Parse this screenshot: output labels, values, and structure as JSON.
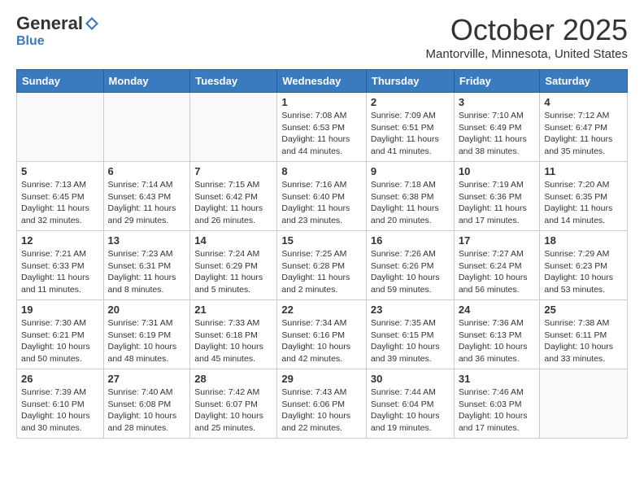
{
  "header": {
    "logo_general": "General",
    "logo_blue": "Blue",
    "month": "October 2025",
    "location": "Mantorville, Minnesota, United States"
  },
  "days_of_week": [
    "Sunday",
    "Monday",
    "Tuesday",
    "Wednesday",
    "Thursday",
    "Friday",
    "Saturday"
  ],
  "weeks": [
    [
      {
        "day": "",
        "info": ""
      },
      {
        "day": "",
        "info": ""
      },
      {
        "day": "",
        "info": ""
      },
      {
        "day": "1",
        "info": "Sunrise: 7:08 AM\nSunset: 6:53 PM\nDaylight: 11 hours and 44 minutes."
      },
      {
        "day": "2",
        "info": "Sunrise: 7:09 AM\nSunset: 6:51 PM\nDaylight: 11 hours and 41 minutes."
      },
      {
        "day": "3",
        "info": "Sunrise: 7:10 AM\nSunset: 6:49 PM\nDaylight: 11 hours and 38 minutes."
      },
      {
        "day": "4",
        "info": "Sunrise: 7:12 AM\nSunset: 6:47 PM\nDaylight: 11 hours and 35 minutes."
      }
    ],
    [
      {
        "day": "5",
        "info": "Sunrise: 7:13 AM\nSunset: 6:45 PM\nDaylight: 11 hours and 32 minutes."
      },
      {
        "day": "6",
        "info": "Sunrise: 7:14 AM\nSunset: 6:43 PM\nDaylight: 11 hours and 29 minutes."
      },
      {
        "day": "7",
        "info": "Sunrise: 7:15 AM\nSunset: 6:42 PM\nDaylight: 11 hours and 26 minutes."
      },
      {
        "day": "8",
        "info": "Sunrise: 7:16 AM\nSunset: 6:40 PM\nDaylight: 11 hours and 23 minutes."
      },
      {
        "day": "9",
        "info": "Sunrise: 7:18 AM\nSunset: 6:38 PM\nDaylight: 11 hours and 20 minutes."
      },
      {
        "day": "10",
        "info": "Sunrise: 7:19 AM\nSunset: 6:36 PM\nDaylight: 11 hours and 17 minutes."
      },
      {
        "day": "11",
        "info": "Sunrise: 7:20 AM\nSunset: 6:35 PM\nDaylight: 11 hours and 14 minutes."
      }
    ],
    [
      {
        "day": "12",
        "info": "Sunrise: 7:21 AM\nSunset: 6:33 PM\nDaylight: 11 hours and 11 minutes."
      },
      {
        "day": "13",
        "info": "Sunrise: 7:23 AM\nSunset: 6:31 PM\nDaylight: 11 hours and 8 minutes."
      },
      {
        "day": "14",
        "info": "Sunrise: 7:24 AM\nSunset: 6:29 PM\nDaylight: 11 hours and 5 minutes."
      },
      {
        "day": "15",
        "info": "Sunrise: 7:25 AM\nSunset: 6:28 PM\nDaylight: 11 hours and 2 minutes."
      },
      {
        "day": "16",
        "info": "Sunrise: 7:26 AM\nSunset: 6:26 PM\nDaylight: 10 hours and 59 minutes."
      },
      {
        "day": "17",
        "info": "Sunrise: 7:27 AM\nSunset: 6:24 PM\nDaylight: 10 hours and 56 minutes."
      },
      {
        "day": "18",
        "info": "Sunrise: 7:29 AM\nSunset: 6:23 PM\nDaylight: 10 hours and 53 minutes."
      }
    ],
    [
      {
        "day": "19",
        "info": "Sunrise: 7:30 AM\nSunset: 6:21 PM\nDaylight: 10 hours and 50 minutes."
      },
      {
        "day": "20",
        "info": "Sunrise: 7:31 AM\nSunset: 6:19 PM\nDaylight: 10 hours and 48 minutes."
      },
      {
        "day": "21",
        "info": "Sunrise: 7:33 AM\nSunset: 6:18 PM\nDaylight: 10 hours and 45 minutes."
      },
      {
        "day": "22",
        "info": "Sunrise: 7:34 AM\nSunset: 6:16 PM\nDaylight: 10 hours and 42 minutes."
      },
      {
        "day": "23",
        "info": "Sunrise: 7:35 AM\nSunset: 6:15 PM\nDaylight: 10 hours and 39 minutes."
      },
      {
        "day": "24",
        "info": "Sunrise: 7:36 AM\nSunset: 6:13 PM\nDaylight: 10 hours and 36 minutes."
      },
      {
        "day": "25",
        "info": "Sunrise: 7:38 AM\nSunset: 6:11 PM\nDaylight: 10 hours and 33 minutes."
      }
    ],
    [
      {
        "day": "26",
        "info": "Sunrise: 7:39 AM\nSunset: 6:10 PM\nDaylight: 10 hours and 30 minutes."
      },
      {
        "day": "27",
        "info": "Sunrise: 7:40 AM\nSunset: 6:08 PM\nDaylight: 10 hours and 28 minutes."
      },
      {
        "day": "28",
        "info": "Sunrise: 7:42 AM\nSunset: 6:07 PM\nDaylight: 10 hours and 25 minutes."
      },
      {
        "day": "29",
        "info": "Sunrise: 7:43 AM\nSunset: 6:06 PM\nDaylight: 10 hours and 22 minutes."
      },
      {
        "day": "30",
        "info": "Sunrise: 7:44 AM\nSunset: 6:04 PM\nDaylight: 10 hours and 19 minutes."
      },
      {
        "day": "31",
        "info": "Sunrise: 7:46 AM\nSunset: 6:03 PM\nDaylight: 10 hours and 17 minutes."
      },
      {
        "day": "",
        "info": ""
      }
    ]
  ]
}
